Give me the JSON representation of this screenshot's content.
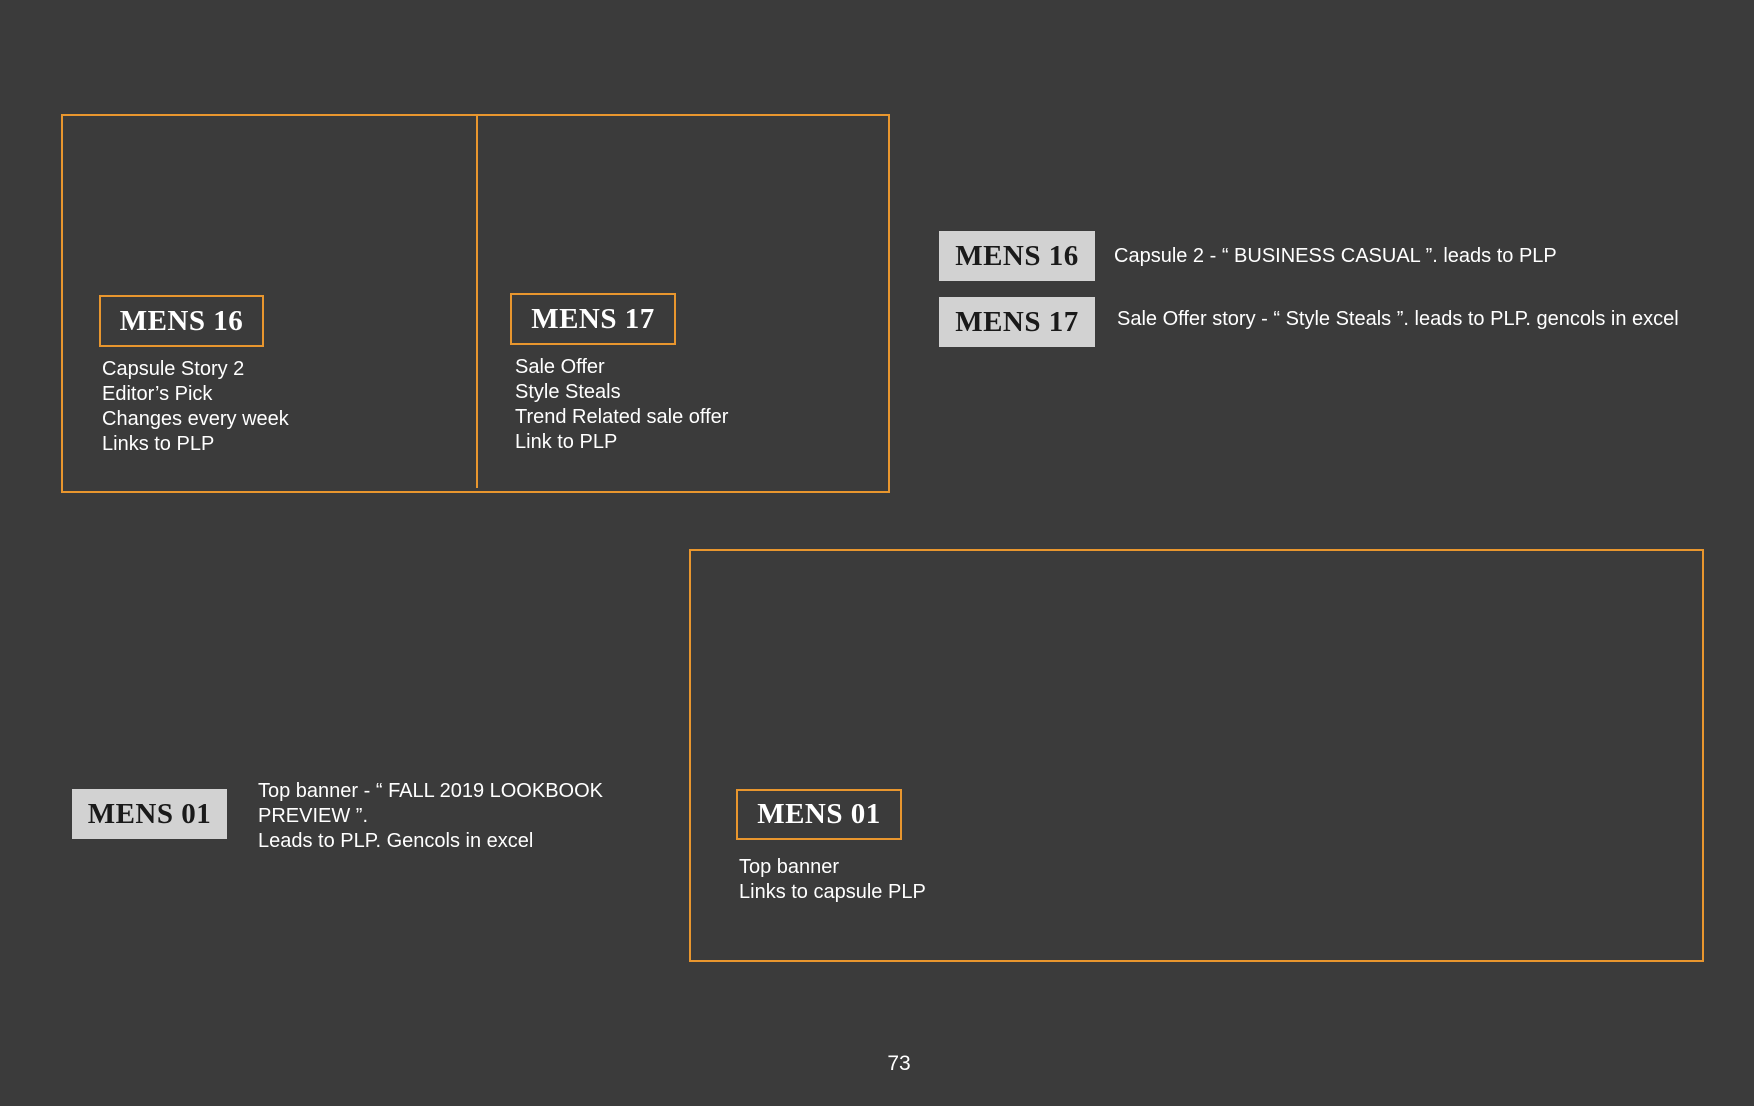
{
  "frames": {
    "top": {
      "left_panel": {
        "tag": "MENS 16",
        "lines": [
          "Capsule Story 2",
          "Editor’s Pick",
          "Changes every week",
          "Links to PLP"
        ]
      },
      "right_panel": {
        "tag": "MENS 17",
        "lines": [
          "Sale Offer",
          "Style Steals",
          "Trend Related sale offer",
          "Link to PLP"
        ]
      }
    },
    "bottom": {
      "tag": "MENS 01",
      "lines": [
        "Top banner",
        "Links to capsule PLP"
      ]
    }
  },
  "legend": [
    {
      "tag": "MENS 16",
      "text": "Capsule 2  -  “ BUSINESS CASUAL ”. leads to PLP"
    },
    {
      "tag": "MENS 17",
      "text": "Sale Offer story  -  “ Style Steals ”. leads to PLP. gencols in excel"
    },
    {
      "tag": "MENS 01",
      "lines": [
        "Top banner -  “ FALL 2019 LOOKBOOK",
        "PREVIEW ”.",
        "Leads to PLP. Gencols in excel"
      ]
    }
  ],
  "page_number": "73",
  "colors": {
    "background": "#3b3b3b",
    "accent": "#e8962e",
    "tag_fill": "#d2d2d2"
  }
}
